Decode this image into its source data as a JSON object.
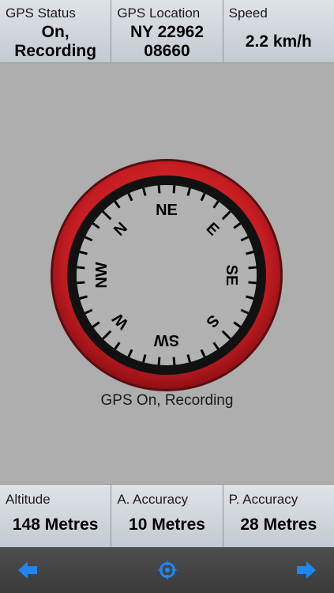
{
  "top_panel": {
    "gps_status": {
      "label": "GPS Status",
      "value_line1": "On,",
      "value_line2": "Recording"
    },
    "gps_location": {
      "label": "GPS Location",
      "value_line1": "NY 22962",
      "value_line2": "08660"
    },
    "speed": {
      "label": "Speed",
      "value": "2.2 km/h"
    }
  },
  "compass": {
    "letters": [
      "N",
      "NE",
      "E",
      "SE",
      "S",
      "SW",
      "W",
      "NW"
    ],
    "ring_color": "#cc1f24"
  },
  "status_caption": "GPS On, Recording",
  "bottom_panel": {
    "altitude": {
      "label": "Altitude",
      "value": "148 Metres"
    },
    "a_accuracy": {
      "label": "A. Accuracy",
      "value": "10 Metres"
    },
    "p_accuracy": {
      "label": "P. Accuracy",
      "value": "28 Metres"
    }
  },
  "toolbar": {
    "left_icon": "back-arrow-icon",
    "center_icon": "compass-locate-icon",
    "right_icon": "forward-arrow-icon",
    "icon_color": "#1f86f2"
  }
}
